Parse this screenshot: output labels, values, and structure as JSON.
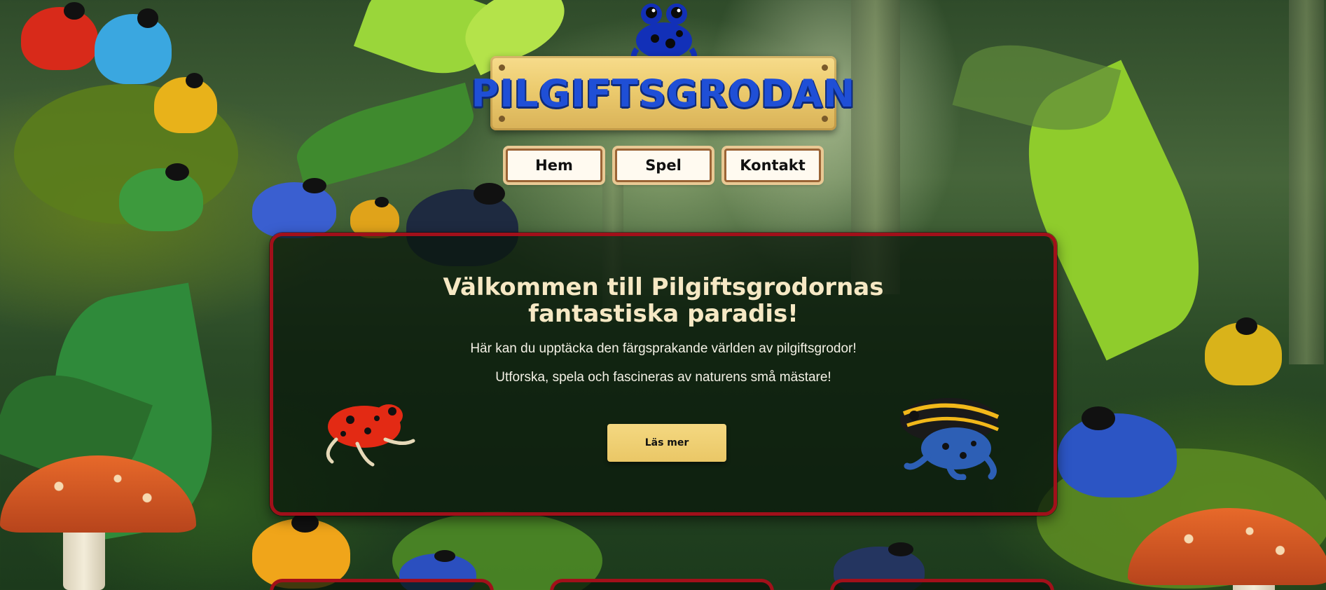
{
  "site": {
    "logo_text": "PILGIFTSGRODAN"
  },
  "nav": {
    "items": [
      {
        "label": "Hem"
      },
      {
        "label": "Spel"
      },
      {
        "label": "Kontakt"
      }
    ]
  },
  "hero": {
    "title_line1": "Välkommen till Pilgiftsgrodornas",
    "title_line2": "fantastiska paradis!",
    "paragraph1": "Här kan du upptäcka den färgsprakande världen av pilgiftsgrodor!",
    "paragraph2": "Utforska, spela och fascineras av naturens små mästare!",
    "button_label": "Läs mer"
  },
  "colors": {
    "card_border": "#a1101a",
    "logo_text": "#1f4fd6",
    "board": "#eccb6e",
    "title": "#f6e8c4"
  },
  "icons": {
    "logo_icon": "blue-poison-dart-frog-icon",
    "hero_left_icon": "red-poison-dart-frog-icon",
    "hero_right_icon": "blue-yellow-poison-dart-frog-icon"
  }
}
